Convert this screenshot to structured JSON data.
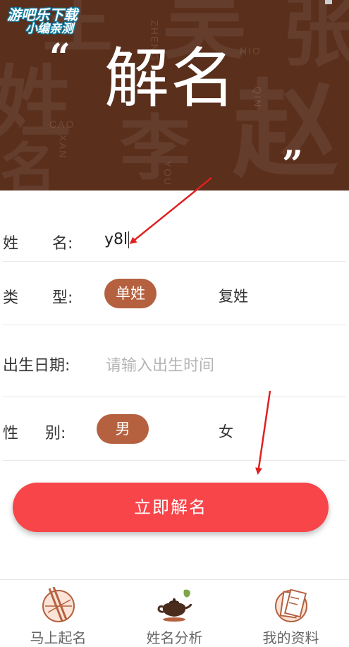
{
  "watermark": {
    "line1": "游吧乐下载",
    "line2": "小编亲测"
  },
  "banner": {
    "title": "解名",
    "quote_open": "“",
    "quote_close": "”",
    "bg_glyphs": [
      "姓",
      "名",
      "赵",
      "王",
      "吴",
      "张",
      "李"
    ],
    "bg_latin": [
      "NIO",
      "QIN",
      "CAO",
      "XAN",
      "ZHENG",
      "YOU"
    ]
  },
  "form": {
    "name": {
      "label_1": "姓",
      "label_2": "名:",
      "value": "y8l"
    },
    "type": {
      "label_1": "类",
      "label_2": "型:",
      "option_selected": "单姓",
      "option_other": "复姓"
    },
    "birth": {
      "label": "出生日期:",
      "placeholder": "请输入出生时间"
    },
    "gender": {
      "label_1": "性",
      "label_2": "别:",
      "option_selected": "男",
      "option_other": "女"
    }
  },
  "submit": {
    "label": "立即解名"
  },
  "tabs": [
    {
      "label": "马上起名",
      "icon": "chopsticks-icon"
    },
    {
      "label": "姓名分析",
      "icon": "teapot-icon"
    },
    {
      "label": "我的资料",
      "icon": "notebook-icon"
    }
  ],
  "colors": {
    "banner_bg": "#5a2f1c",
    "pill": "#b5613f",
    "submit": "#f7454a",
    "arrow": "#e02020"
  }
}
